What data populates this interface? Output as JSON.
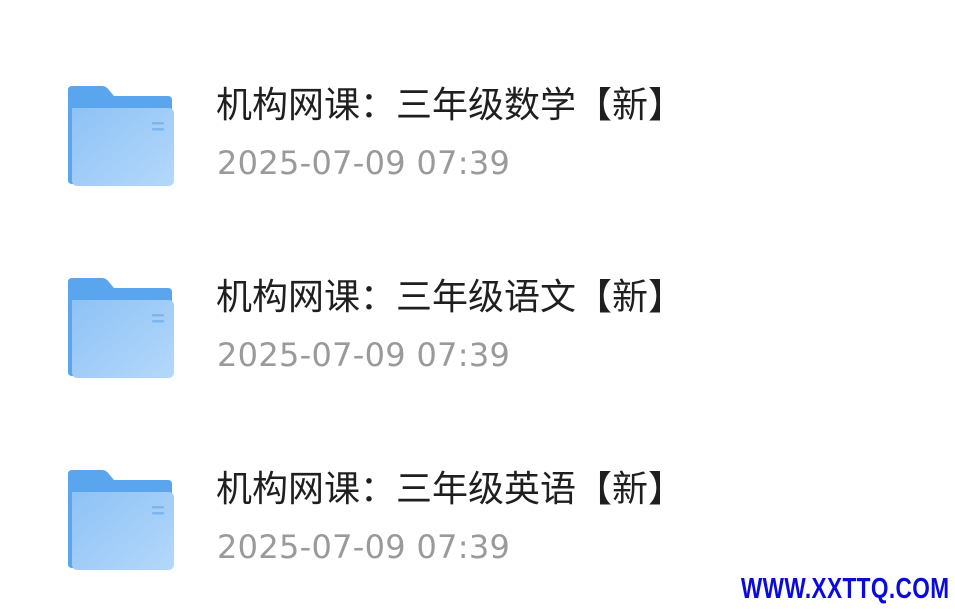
{
  "files": [
    {
      "name": "机构网课：三年级数学【新】",
      "modified": "2025-07-09 07:39",
      "icon": "folder-icon"
    },
    {
      "name": "机构网课：三年级语文【新】",
      "modified": "2025-07-09 07:39",
      "icon": "folder-icon"
    },
    {
      "name": "机构网课：三年级英语【新】",
      "modified": "2025-07-09 07:39",
      "icon": "folder-icon"
    }
  ],
  "watermark": {
    "text": "WWW.XXTTQ.COM",
    "color": "#0a0adc"
  },
  "colors": {
    "folder_back": "#5aa6ee",
    "folder_front_light": "#b4d8fb",
    "folder_front_dark": "#8ec2f5",
    "title_text": "#1f1f1f",
    "meta_text": "#9a9a9a"
  }
}
